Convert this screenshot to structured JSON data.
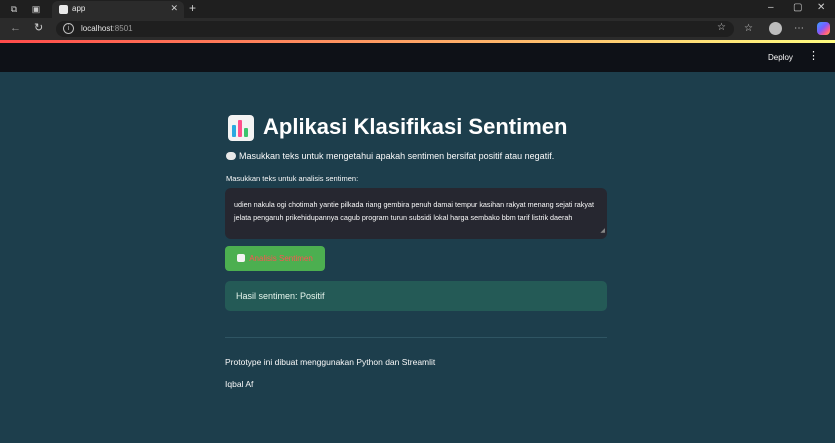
{
  "browser": {
    "tab": {
      "title": "app",
      "close": "✕"
    },
    "new_tab": "+",
    "url_host": "localhost",
    "url_port": ":8501",
    "window_controls": [
      "–",
      "▢",
      "✕"
    ]
  },
  "header": {
    "deploy_label": "Deploy",
    "menu_icon": "⋮"
  },
  "app": {
    "title": "Aplikasi Klasifikasi Sentimen",
    "intro": "Masukkan teks untuk mengetahui apakah sentimen bersifat positif atau negatif.",
    "input_label": "Masukkan teks untuk analisis sentimen:",
    "input_value": "udien nakula ogi chotimah yantie pilkada riang gembira penuh damai tempur kasihan rakyat menang sejati rakyat jelata pengaruh prikehidupannya cagub program turun subsidi lokal harga sembako bbm tarif listrik daerah",
    "button_label": "Analisis Sentimen",
    "result_text": "Hasil sentimen: Positif",
    "footer_line1": "Prototype ini dibuat menggunakan Python dan Streamlit",
    "footer_line2": "Iqbal Af"
  },
  "colors": {
    "background": "#1d3e4c",
    "header": "#0e1117",
    "button": "#4caf50",
    "button_text": "#ff5252",
    "result_bg": "#245a56"
  },
  "icons": {
    "app_icon": "bar-chart-icon",
    "intro_icon": "speech-bubble-icon",
    "button_icon": "rocket-icon"
  }
}
